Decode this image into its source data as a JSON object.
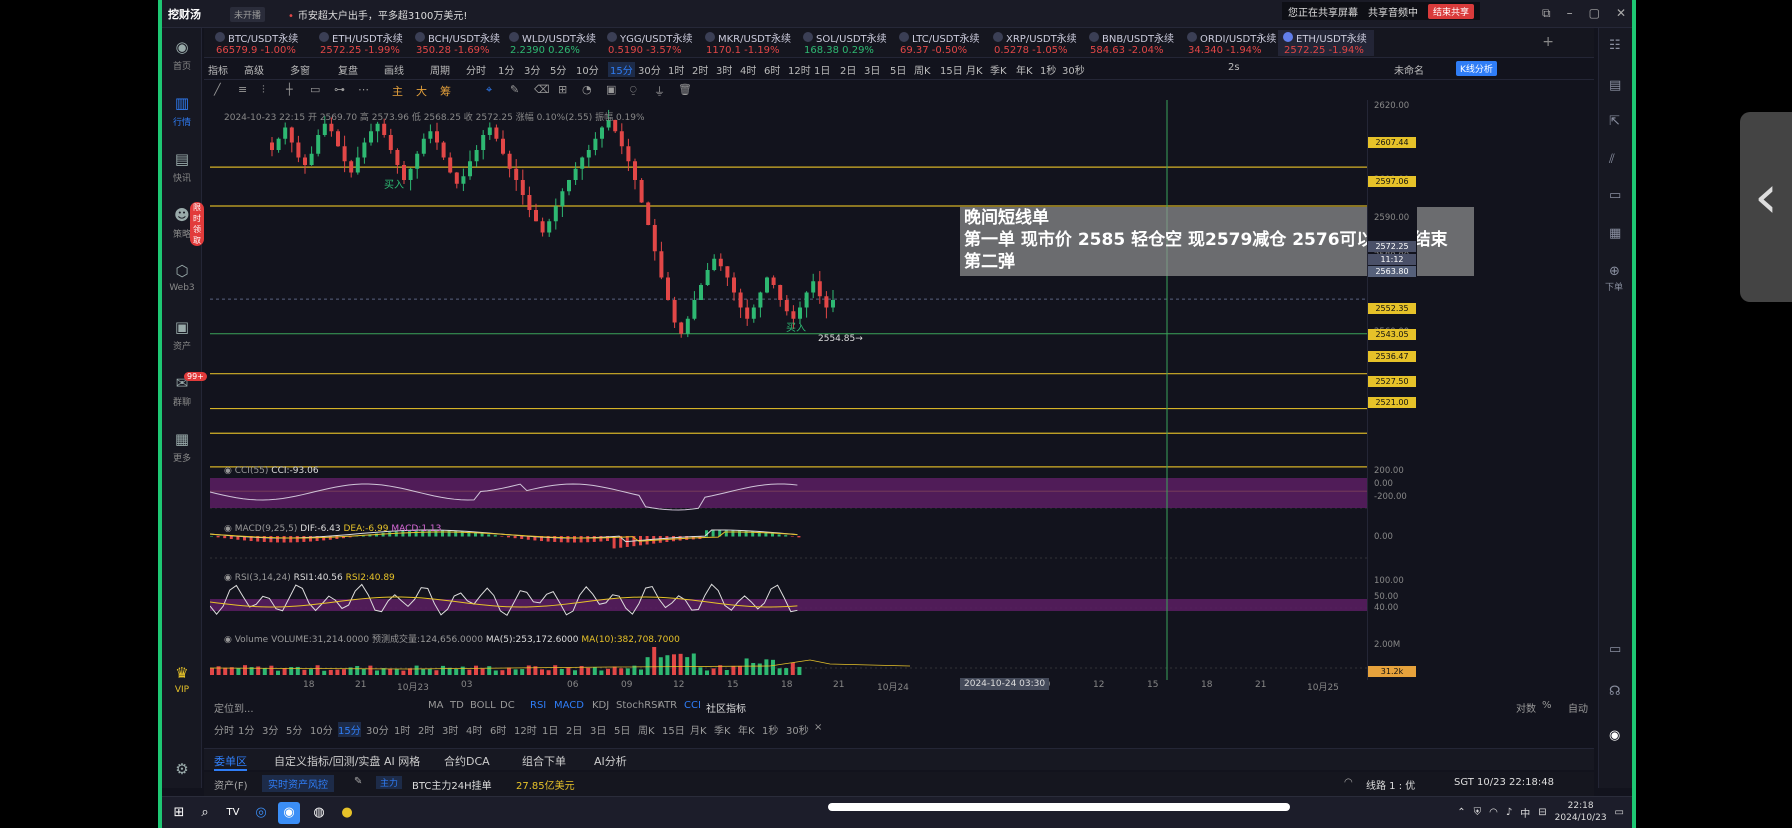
{
  "titlebar": {
    "app": "挖财汤",
    "version": "未开播",
    "news": "币安超大户出手，平多超3100万美元!",
    "share_status": "您正在共享屏幕",
    "audio": "共享音频中",
    "end_share": "结束共享"
  },
  "left_nav": [
    {
      "label": "首页",
      "icon": "home-icon"
    },
    {
      "label": "行情",
      "icon": "chart-icon"
    },
    {
      "label": "快讯",
      "icon": "news-icon"
    },
    {
      "label": "策略",
      "icon": "robot-icon",
      "badge": "限时领取"
    },
    {
      "label": "Web3",
      "icon": "web3-icon"
    },
    {
      "label": "资产",
      "icon": "wallet-icon"
    },
    {
      "label": "群聊",
      "icon": "chat-icon",
      "badge": "99+"
    },
    {
      "label": "更多",
      "icon": "grid-icon"
    }
  ],
  "left_bottom": {
    "vip": "VIP"
  },
  "right_rail": {
    "order": "下单"
  },
  "tickers": [
    {
      "name": "BTC/USDT永续",
      "value": "66579.9 -1.00%",
      "up": false
    },
    {
      "name": "ETH/USDT永续",
      "value": "2572.25 -1.99%",
      "up": false
    },
    {
      "name": "BCH/USDT永续",
      "value": "350.28 -1.69%",
      "up": false
    },
    {
      "name": "WLD/USDT永续",
      "value": "2.2390 0.26%",
      "up": true
    },
    {
      "name": "YGG/USDT永续",
      "value": "0.5190 -3.57%",
      "up": false
    },
    {
      "name": "MKR/USDT永续",
      "value": "1170.1 -1.19%",
      "up": false
    },
    {
      "name": "SOL/USDT永续",
      "value": "168.38 0.29%",
      "up": true
    },
    {
      "name": "LTC/USDT永续",
      "value": "69.37 -0.50%",
      "up": false
    },
    {
      "name": "XRP/USDT永续",
      "value": "0.5278 -1.05%",
      "up": false
    },
    {
      "name": "BNB/USDT永续",
      "value": "584.63 -2.04%",
      "up": false
    },
    {
      "name": "ORDI/USDT永续",
      "value": "34.340 -1.94%",
      "up": false
    },
    {
      "name": "ETH/USDT永续",
      "value": "2572.25 -1.94%",
      "up": false
    }
  ],
  "toolbar": {
    "items": [
      "指标",
      "高级",
      "多窗",
      "复盘",
      "画线",
      "周期",
      "分时",
      "1分",
      "3分",
      "5分",
      "10分",
      "15分",
      "30分",
      "1时",
      "2时",
      "3时",
      "4时",
      "6时",
      "12时",
      "1日",
      "2日",
      "3日",
      "5日",
      "周K",
      "15日",
      "月K",
      "季K",
      "年K",
      "1秒",
      "30秒"
    ],
    "selected": "15分",
    "right_items": [
      "2s",
      "未命名"
    ],
    "kline": "K线分析"
  },
  "draw_tools": [
    "主",
    "大",
    "筹"
  ],
  "chart": {
    "info": "2024-10-23 22:15 开 2569.70 高 2573.96 低 2568.25 收 2572.25 涨幅 0.10%(2.55) 振幅 0.19%",
    "annotation": [
      "晚间短线单",
      "第一单 现市价 2585 轻仓空 现2579减仓 2576可以出完  结束",
      "第二弹"
    ],
    "buy_label": "买入",
    "low_label": "2554.85→",
    "current_price": "2572.25",
    "countdown": "11:12",
    "crosshair_price": "2563.80",
    "crosshair_time": "2024-10-24 03:30"
  },
  "price_ticks": [
    "2620.00",
    "2610.00",
    "2600.00",
    "2590.00",
    "2580.00",
    "2570.00",
    "2560.00",
    "2550.00"
  ],
  "level_lines": [
    "2607.44",
    "2597.06",
    "2552.35",
    "2543.05",
    "2536.47",
    "2527.50",
    "2521.00"
  ],
  "indicators": {
    "cci": {
      "name": "CCI(55)",
      "value": "CCI:-93.06",
      "ticks": [
        "200.00",
        "0.00",
        "-200.00"
      ]
    },
    "macd": {
      "name": "MACD(9,25,5)",
      "dif": "DIF:-6.43",
      "dea": "DEA:-6.99",
      "macd": "MACD:1.13",
      "tick": "0.00"
    },
    "rsi": {
      "name": "RSI(3,14,24)",
      "rsi1": "RSI1:40.56",
      "rsi2": "RSI2:40.89",
      "ticks": [
        "100.00",
        "50.00",
        "40.00"
      ]
    },
    "volume": {
      "name": "Volume",
      "vol": "VOLUME:31,214.0000",
      "pred": "预测成交量:124,656.0000",
      "ma5": "MA(5):253,172.6000",
      "ma10": "MA(10):382,708.7000",
      "ticks": [
        "2.00M",
        "31.2k"
      ]
    }
  },
  "time_ticks": [
    "18",
    "21",
    "10月23",
    "03",
    "06",
    "09",
    "12",
    "15",
    "18",
    "21",
    "10月24",
    "06",
    "09",
    "12",
    "15",
    "18",
    "21",
    "10月25",
    "03"
  ],
  "indicator_bar": {
    "left": "定位到...",
    "items": [
      "MA",
      "TD",
      "BOLL",
      "DC",
      "RSI",
      "MACD",
      "KDJ",
      "StochRSI",
      "ATR",
      "CCI",
      "社区指标"
    ],
    "right": [
      "对数",
      "%",
      "自动"
    ]
  },
  "tf_bar": [
    "分时",
    "1分",
    "3分",
    "5分",
    "10分",
    "15分",
    "30分",
    "1时",
    "2时",
    "3时",
    "4时",
    "6时",
    "12时",
    "1日",
    "2日",
    "3日",
    "5日",
    "周K",
    "15日",
    "月K",
    "季K",
    "年K",
    "1秒",
    "30秒"
  ],
  "bottom_tabs": [
    "委单区",
    "自定义指标/回测/实盘",
    "AI 网格",
    "合约DCA",
    "组合下单",
    "AI分析"
  ],
  "status": {
    "asset": "资产(F)",
    "risk": "实时资产风控",
    "main": "主力",
    "btc": "BTC主力24H挂单",
    "btc_value": "27.85亿美元",
    "route": "线路 1 : 优",
    "time": "SGT 10/23 22:18:48"
  },
  "taskbar": {
    "time": "22:18",
    "date": "2024/10/23",
    "ime": "中"
  }
}
